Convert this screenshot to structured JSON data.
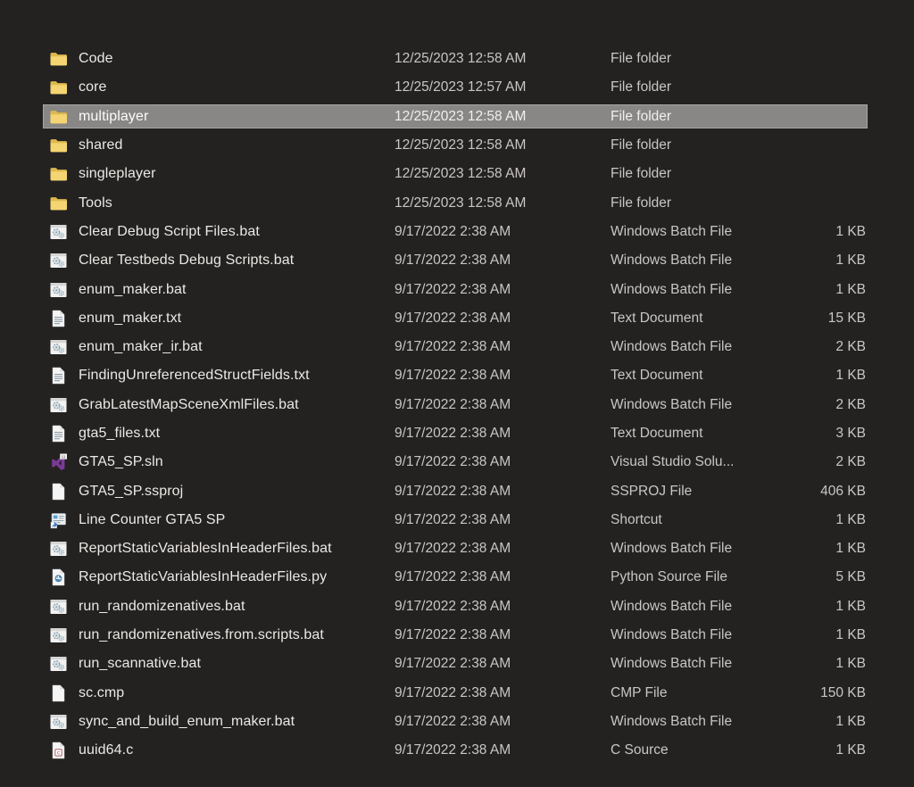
{
  "window": {
    "app": "File Explorer",
    "view": "Details list",
    "background_color": "#232221",
    "selection_fill_color": "#888786",
    "selection_border_color": "#a6a6a6",
    "text_color_primary": "#ebe8e5",
    "text_color_secondary": "#c9c6c4",
    "folder_icon_color": "#f4d572",
    "visual_studio_purple": "#7b3a96",
    "python_blue": "#4584b6"
  },
  "rows": [
    {
      "name": "Code",
      "date": "12/25/2023 12:58 AM",
      "type": "File folder",
      "size": "",
      "icon": "folder-icon",
      "selected": false
    },
    {
      "name": "core",
      "date": "12/25/2023 12:57 AM",
      "type": "File folder",
      "size": "",
      "icon": "folder-icon",
      "selected": false
    },
    {
      "name": "multiplayer",
      "date": "12/25/2023 12:58 AM",
      "type": "File folder",
      "size": "",
      "icon": "folder-icon",
      "selected": true
    },
    {
      "name": "shared",
      "date": "12/25/2023 12:58 AM",
      "type": "File folder",
      "size": "",
      "icon": "folder-icon",
      "selected": false
    },
    {
      "name": "singleplayer",
      "date": "12/25/2023 12:58 AM",
      "type": "File folder",
      "size": "",
      "icon": "folder-icon",
      "selected": false
    },
    {
      "name": "Tools",
      "date": "12/25/2023 12:58 AM",
      "type": "File folder",
      "size": "",
      "icon": "folder-icon",
      "selected": false
    },
    {
      "name": "Clear Debug Script Files.bat",
      "date": "9/17/2022 2:38 AM",
      "type": "Windows Batch File",
      "size": "1 KB",
      "icon": "batch-file-icon",
      "selected": false
    },
    {
      "name": "Clear Testbeds Debug Scripts.bat",
      "date": "9/17/2022 2:38 AM",
      "type": "Windows Batch File",
      "size": "1 KB",
      "icon": "batch-file-icon",
      "selected": false
    },
    {
      "name": "enum_maker.bat",
      "date": "9/17/2022 2:38 AM",
      "type": "Windows Batch File",
      "size": "1 KB",
      "icon": "batch-file-icon",
      "selected": false
    },
    {
      "name": "enum_maker.txt",
      "date": "9/17/2022 2:38 AM",
      "type": "Text Document",
      "size": "15 KB",
      "icon": "text-document-icon",
      "selected": false
    },
    {
      "name": "enum_maker_ir.bat",
      "date": "9/17/2022 2:38 AM",
      "type": "Windows Batch File",
      "size": "2 KB",
      "icon": "batch-file-icon",
      "selected": false
    },
    {
      "name": "FindingUnreferencedStructFields.txt",
      "date": "9/17/2022 2:38 AM",
      "type": "Text Document",
      "size": "1 KB",
      "icon": "text-document-icon",
      "selected": false
    },
    {
      "name": "GrabLatestMapSceneXmlFiles.bat",
      "date": "9/17/2022 2:38 AM",
      "type": "Windows Batch File",
      "size": "2 KB",
      "icon": "batch-file-icon",
      "selected": false
    },
    {
      "name": "gta5_files.txt",
      "date": "9/17/2022 2:38 AM",
      "type": "Text Document",
      "size": "3 KB",
      "icon": "text-document-icon",
      "selected": false
    },
    {
      "name": "GTA5_SP.sln",
      "date": "9/17/2022 2:38 AM",
      "type": "Visual Studio Solu...",
      "size": "2 KB",
      "icon": "visual-studio-solution-icon",
      "selected": false
    },
    {
      "name": "GTA5_SP.ssproj",
      "date": "9/17/2022 2:38 AM",
      "type": "SSPROJ File",
      "size": "406 KB",
      "icon": "document-icon",
      "selected": false
    },
    {
      "name": "Line Counter GTA5 SP",
      "date": "9/17/2022 2:38 AM",
      "type": "Shortcut",
      "size": "1 KB",
      "icon": "shortcut-icon",
      "selected": false
    },
    {
      "name": "ReportStaticVariablesInHeaderFiles.bat",
      "date": "9/17/2022 2:38 AM",
      "type": "Windows Batch File",
      "size": "1 KB",
      "icon": "batch-file-icon",
      "selected": false
    },
    {
      "name": "ReportStaticVariablesInHeaderFiles.py",
      "date": "9/17/2022 2:38 AM",
      "type": "Python Source File",
      "size": "5 KB",
      "icon": "python-file-icon",
      "selected": false
    },
    {
      "name": "run_randomizenatives.bat",
      "date": "9/17/2022 2:38 AM",
      "type": "Windows Batch File",
      "size": "1 KB",
      "icon": "batch-file-icon",
      "selected": false
    },
    {
      "name": "run_randomizenatives.from.scripts.bat",
      "date": "9/17/2022 2:38 AM",
      "type": "Windows Batch File",
      "size": "1 KB",
      "icon": "batch-file-icon",
      "selected": false
    },
    {
      "name": "run_scannative.bat",
      "date": "9/17/2022 2:38 AM",
      "type": "Windows Batch File",
      "size": "1 KB",
      "icon": "batch-file-icon",
      "selected": false
    },
    {
      "name": "sc.cmp",
      "date": "9/17/2022 2:38 AM",
      "type": "CMP File",
      "size": "150 KB",
      "icon": "document-icon",
      "selected": false
    },
    {
      "name": "sync_and_build_enum_maker.bat",
      "date": "9/17/2022 2:38 AM",
      "type": "Windows Batch File",
      "size": "1 KB",
      "icon": "batch-file-icon",
      "selected": false
    },
    {
      "name": "uuid64.c",
      "date": "9/17/2022 2:38 AM",
      "type": "C Source",
      "size": "1 KB",
      "icon": "c-source-icon",
      "selected": false
    }
  ]
}
